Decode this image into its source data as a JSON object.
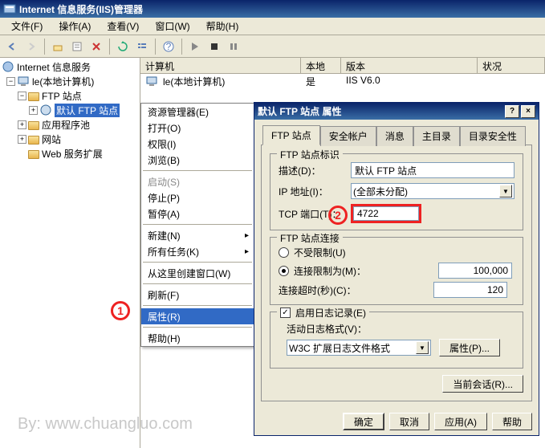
{
  "window": {
    "title": "Internet 信息服务(IIS)管理器"
  },
  "menubar": {
    "file": "文件(F)",
    "operate": "操作(A)",
    "view": "查看(V)",
    "window": "窗口(W)",
    "help": "帮助(H)"
  },
  "tree": {
    "root": "Internet 信息服务",
    "computer": "le(本地计算机)",
    "ftp_sites": "FTP 站点",
    "default_ftp": "默认 FTP 站点",
    "app_pools": "应用程序池",
    "websites": "网站",
    "web_ext": "Web 服务扩展"
  },
  "list": {
    "headers": {
      "computer": "计算机",
      "local": "本地",
      "version": "版本",
      "status": "状况"
    },
    "row": {
      "computer": "le(本地计算机)",
      "local": "是",
      "version": "IIS V6.0",
      "status": ""
    }
  },
  "ctx": {
    "explorer": "资源管理器(E)",
    "open": "打开(O)",
    "permissions": "权限(I)",
    "browse": "浏览(B)",
    "start": "启动(S)",
    "stop": "停止(P)",
    "pause": "暂停(A)",
    "new": "新建(N)",
    "all_tasks": "所有任务(K)",
    "new_window": "从这里创建窗口(W)",
    "refresh": "刷新(F)",
    "properties": "属性(R)",
    "help": "帮助(H)"
  },
  "dialog": {
    "title": "默认 FTP 站点 属性",
    "tabs": {
      "site": "FTP 站点",
      "security_acct": "安全帐户",
      "messages": "消息",
      "home_dir": "主目录",
      "dir_security": "目录安全性"
    },
    "group_id": "FTP 站点标识",
    "desc_label": "描述(D)：",
    "desc_value": "默认 FTP 站点",
    "ip_label": "IP 地址(I)：",
    "ip_value": "(全部未分配)",
    "port_label": "TCP 端口(T)：",
    "port_value": "4722",
    "group_conn": "FTP 站点连接",
    "unlimited": "不受限制(U)",
    "limited": "连接限制为(M)：",
    "limited_value": "100,000",
    "timeout_label": "连接超时(秒)(C)：",
    "timeout_value": "120",
    "enable_log": "启用日志记录(E)",
    "log_format_label": "活动日志格式(V)：",
    "log_format_value": "W3C 扩展日志文件格式",
    "props_btn": "属性(P)...",
    "current_sessions": "当前会话(R)...",
    "ok": "确定",
    "cancel": "取消",
    "apply": "应用(A)",
    "help": "帮助"
  },
  "markers": {
    "m1": "1",
    "m2": "2"
  },
  "watermark": "By: www.chuangluo.com"
}
